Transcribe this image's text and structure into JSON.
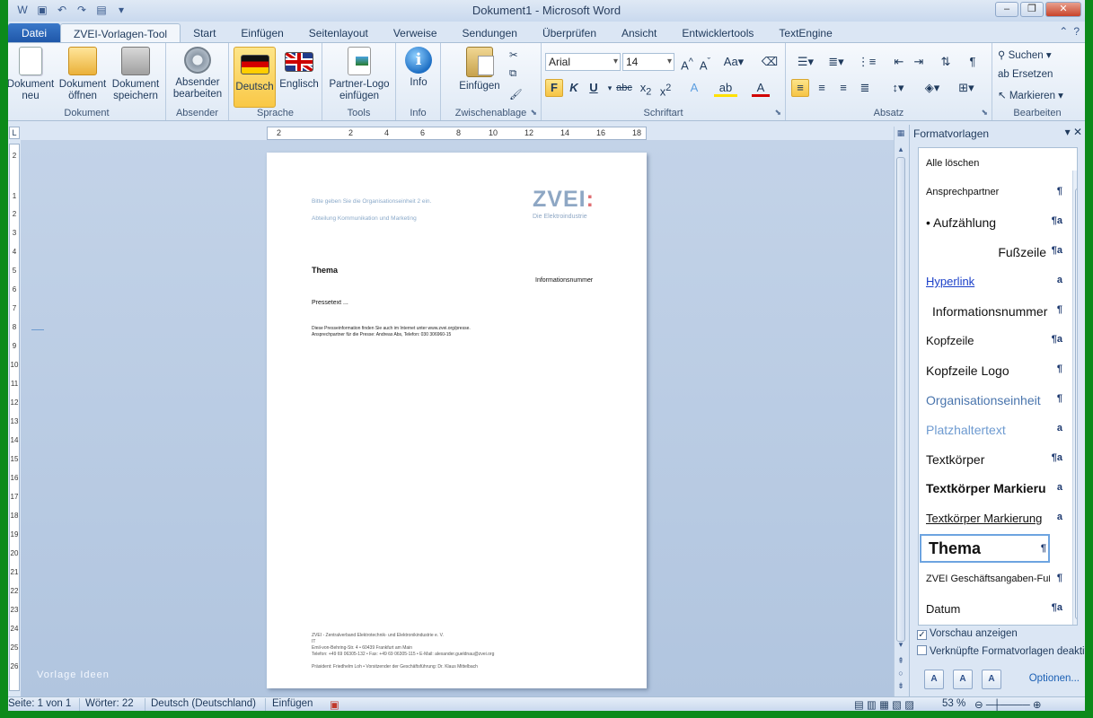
{
  "window": {
    "title": "Dokument1 - Microsoft Word"
  },
  "tabs": [
    "Datei",
    "ZVEI-Vorlagen-Tool",
    "Start",
    "Einfügen",
    "Seitenlayout",
    "Verweise",
    "Sendungen",
    "Überprüfen",
    "Ansicht",
    "Entwicklertools",
    "TextEngine"
  ],
  "active_tab": "ZVEI-Vorlagen-Tool",
  "ribbon": {
    "dokument": {
      "label": "Dokument",
      "neu": "Dokument neu",
      "oeffnen": "Dokument öffnen",
      "speichern": "Dokument speichern"
    },
    "absender": {
      "label": "Absender",
      "bearbeiten": "Absender bearbeiten"
    },
    "sprache": {
      "label": "Sprache",
      "deutsch": "Deutsch",
      "englisch": "Englisch"
    },
    "tools": {
      "label": "Tools",
      "partner_logo": "Partner-Logo einfügen"
    },
    "info": {
      "label": "Info",
      "info": "Info"
    },
    "zwischenablage": {
      "label": "Zwischenablage",
      "einfuegen": "Einfügen"
    },
    "schriftart": {
      "label": "Schriftart",
      "font": "Arial",
      "size": "14"
    },
    "absatz": {
      "label": "Absatz"
    },
    "bearbeiten": {
      "label": "Bearbeiten",
      "suchen": "Suchen",
      "ersetzen": "Ersetzen",
      "markieren": "Markieren"
    }
  },
  "ruler": {
    "h_numbers": [
      "2",
      "2",
      "4",
      "6",
      "8",
      "10",
      "12",
      "14",
      "16",
      "18"
    ],
    "v_numbers": [
      "2",
      "1",
      "2",
      "3",
      "4",
      "5",
      "6",
      "7",
      "8",
      "9",
      "10",
      "11",
      "12",
      "13",
      "14",
      "15",
      "16",
      "17",
      "18",
      "19",
      "20",
      "21",
      "22",
      "23",
      "24",
      "25",
      "26"
    ]
  },
  "document": {
    "org1": "Bitte geben Sie die Organisationseinheit 2 ein.",
    "org2": "Abteilung Kommunikation und Marketing",
    "logo": "ZVEI",
    "logo_colon": ":",
    "logo_sub": "Die Elektroindustrie",
    "thema": "Thema",
    "informationsnummer": "Informationsnummer",
    "pressetext": "Pressetext ...",
    "internet_line": "Diese Presseinformation finden Sie auch im Internet unter www.zvei.org/presse.",
    "contact_line": "Ansprechpartner für die Presse: Andreas Abs, Telefon: 030 306960-15",
    "footer1": "ZVEI - Zentralverband Elektrotechnik- und Elektronikindustrie e. V.",
    "footer2": "IT",
    "footer3": "Emil-von-Behring-Str. 4 • 60439 Frankfurt am Main",
    "footer4": "Telefon: +49 69 06305-132 • Fax: +49 69 06305-115 • E-Mail: alexander.gueldnau@zvei.org",
    "footer5": "Präsident: Friedhelm Loh • Vorsitzender der Geschäftsführung: Dr. Klaus Mittelbach"
  },
  "watermark": "Vorlage Ideen",
  "styles_pane": {
    "title": "Formatvorlagen",
    "items": [
      {
        "name": "Alle löschen",
        "mark": ""
      },
      {
        "name": "Ansprechpartner",
        "mark": "¶"
      },
      {
        "name": "• Aufzählung",
        "mark": "¶a"
      },
      {
        "name": "Fußzeile",
        "mark": "¶a"
      },
      {
        "name": "Hyperlink",
        "mark": "a"
      },
      {
        "name": "Informationsnummer",
        "mark": "¶"
      },
      {
        "name": "Kopfzeile",
        "mark": "¶a"
      },
      {
        "name": "Kopfzeile Logo",
        "mark": "¶"
      },
      {
        "name": "Organisationseinheit",
        "mark": "¶"
      },
      {
        "name": "Platzhaltertext",
        "mark": "a"
      },
      {
        "name": "Textkörper",
        "mark": "¶a"
      },
      {
        "name": "Textkörper Markieru",
        "mark": "a"
      },
      {
        "name": "Textkörper Markierung",
        "mark": "a"
      },
      {
        "name": "Thema",
        "mark": "¶"
      },
      {
        "name": "ZVEI Geschäftsangaben-Fußz",
        "mark": "¶"
      },
      {
        "name": "Datum",
        "mark": "¶a"
      }
    ],
    "preview_label": "Vorschau anzeigen",
    "preview_checked": true,
    "linked_label": "Verknüpfte Formatvorlagen deaktivi",
    "linked_checked": false,
    "options": "Optionen..."
  },
  "status": {
    "page": "Seite: 1 von 1",
    "words": "Wörter: 22",
    "language": "Deutsch (Deutschland)",
    "mode": "Einfügen",
    "zoom": "53 %"
  }
}
